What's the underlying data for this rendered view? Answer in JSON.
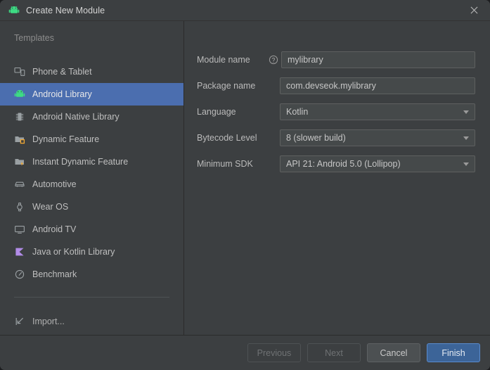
{
  "window": {
    "title": "Create New Module",
    "title_icon": "android-robot-icon",
    "close_icon": "close-icon",
    "accent_selected": "#4b6eaf",
    "primary_button_color": "#3c6498",
    "background": "#3c3f41"
  },
  "sidebar": {
    "header": "Templates",
    "items": [
      {
        "label": "Phone & Tablet",
        "icon": "phone-tablet-icon",
        "selected": false
      },
      {
        "label": "Android Library",
        "icon": "android-robot-icon",
        "selected": true
      },
      {
        "label": "Android Native Library",
        "icon": "native-chip-icon",
        "selected": false
      },
      {
        "label": "Dynamic Feature",
        "icon": "folder-dynamic-icon",
        "selected": false
      },
      {
        "label": "Instant Dynamic Feature",
        "icon": "folder-instant-icon",
        "selected": false
      },
      {
        "label": "Automotive",
        "icon": "car-icon",
        "selected": false
      },
      {
        "label": "Wear OS",
        "icon": "watch-icon",
        "selected": false
      },
      {
        "label": "Android TV",
        "icon": "tv-icon",
        "selected": false
      },
      {
        "label": "Java or Kotlin Library",
        "icon": "java-kotlin-library-icon",
        "selected": false
      },
      {
        "label": "Benchmark",
        "icon": "benchmark-gauge-icon",
        "selected": false
      }
    ],
    "import": {
      "label": "Import...",
      "icon": "import-arrow-icon"
    }
  },
  "form": {
    "fields": [
      {
        "label": "Module name",
        "value": "mylibrary",
        "type": "text",
        "help": true,
        "help_icon": "help-circle-icon"
      },
      {
        "label": "Package name",
        "value": "com.devseok.mylibrary",
        "type": "text",
        "help": false
      },
      {
        "label": "Language",
        "value": "Kotlin",
        "type": "combo",
        "help": false,
        "arrow_icon": "chevron-down-icon"
      },
      {
        "label": "Bytecode Level",
        "value": "8 (slower build)",
        "type": "combo",
        "help": false,
        "arrow_icon": "chevron-down-icon"
      },
      {
        "label": "Minimum SDK",
        "value": "API 21: Android 5.0 (Lollipop)",
        "type": "combo",
        "help": false,
        "arrow_icon": "chevron-down-icon"
      }
    ]
  },
  "footer": {
    "buttons": [
      {
        "label": "Previous",
        "state": "disabled"
      },
      {
        "label": "Next",
        "state": "disabled"
      },
      {
        "label": "Cancel",
        "state": "normal"
      },
      {
        "label": "Finish",
        "state": "primary"
      }
    ]
  }
}
